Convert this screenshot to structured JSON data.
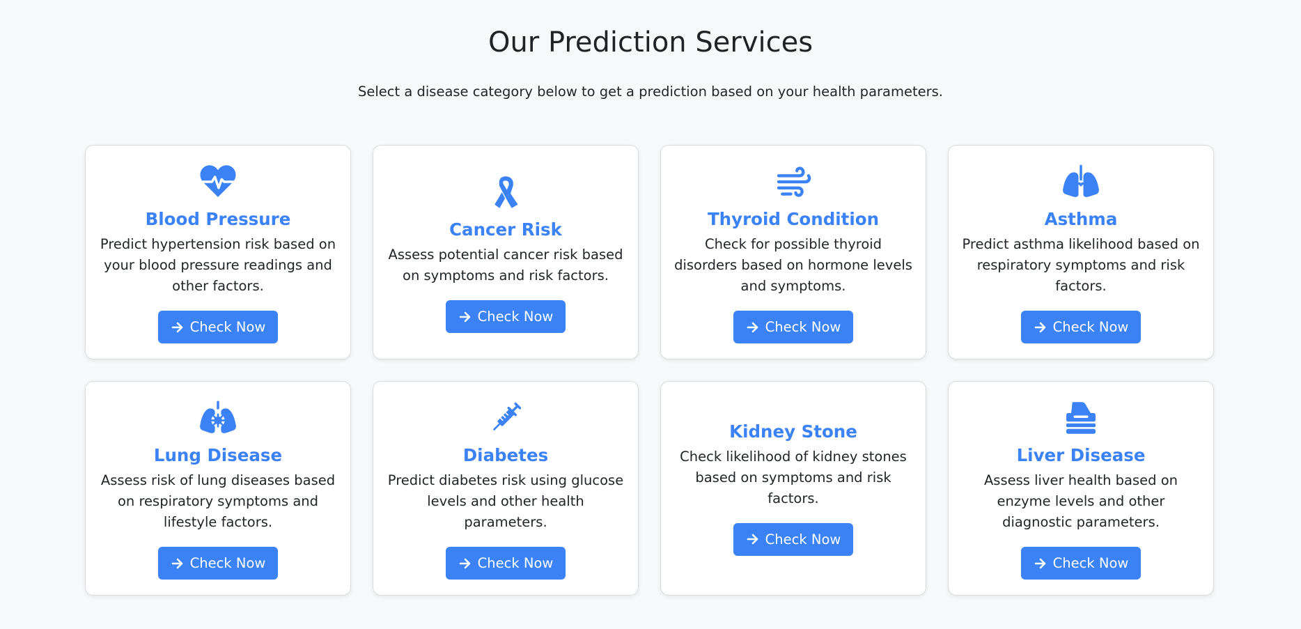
{
  "header": {
    "title": "Our Prediction Services",
    "subtitle": "Select a disease category below to get a prediction based on your health parameters."
  },
  "colors": {
    "accent": "#3b82f6",
    "background": "#f7f8fa",
    "card": "#ffffff"
  },
  "cards": [
    {
      "icon": "heart-pulse-icon",
      "title": "Blood Pressure",
      "description": "Predict hypertension risk based on your blood pressure readings and other factors.",
      "button": "Check Now"
    },
    {
      "icon": "ribbon-icon",
      "title": "Cancer Risk",
      "description": "Assess potential cancer risk based on symptoms and risk factors.",
      "button": "Check Now"
    },
    {
      "icon": "wind-icon",
      "title": "Thyroid Condition",
      "description": "Check for possible thyroid disorders based on hormone levels and symptoms.",
      "button": "Check Now"
    },
    {
      "icon": "lungs-icon",
      "title": "Asthma",
      "description": "Predict asthma likelihood based on respiratory symptoms and risk factors.",
      "button": "Check Now"
    },
    {
      "icon": "lungs-virus-icon",
      "title": "Lung Disease",
      "description": "Assess risk of lung diseases based on respiratory symptoms and lifestyle factors.",
      "button": "Check Now"
    },
    {
      "icon": "syringe-icon",
      "title": "Diabetes",
      "description": "Predict diabetes risk using glucose levels and other health parameters.",
      "button": "Check Now"
    },
    {
      "icon": "",
      "title": "Kidney Stone",
      "description": "Check likelihood of kidney stones based on symptoms and risk factors.",
      "button": "Check Now"
    },
    {
      "icon": "tissue-box-icon",
      "title": "Liver Disease",
      "description": "Assess liver health based on enzyme levels and other diagnostic parameters.",
      "button": "Check Now"
    }
  ]
}
